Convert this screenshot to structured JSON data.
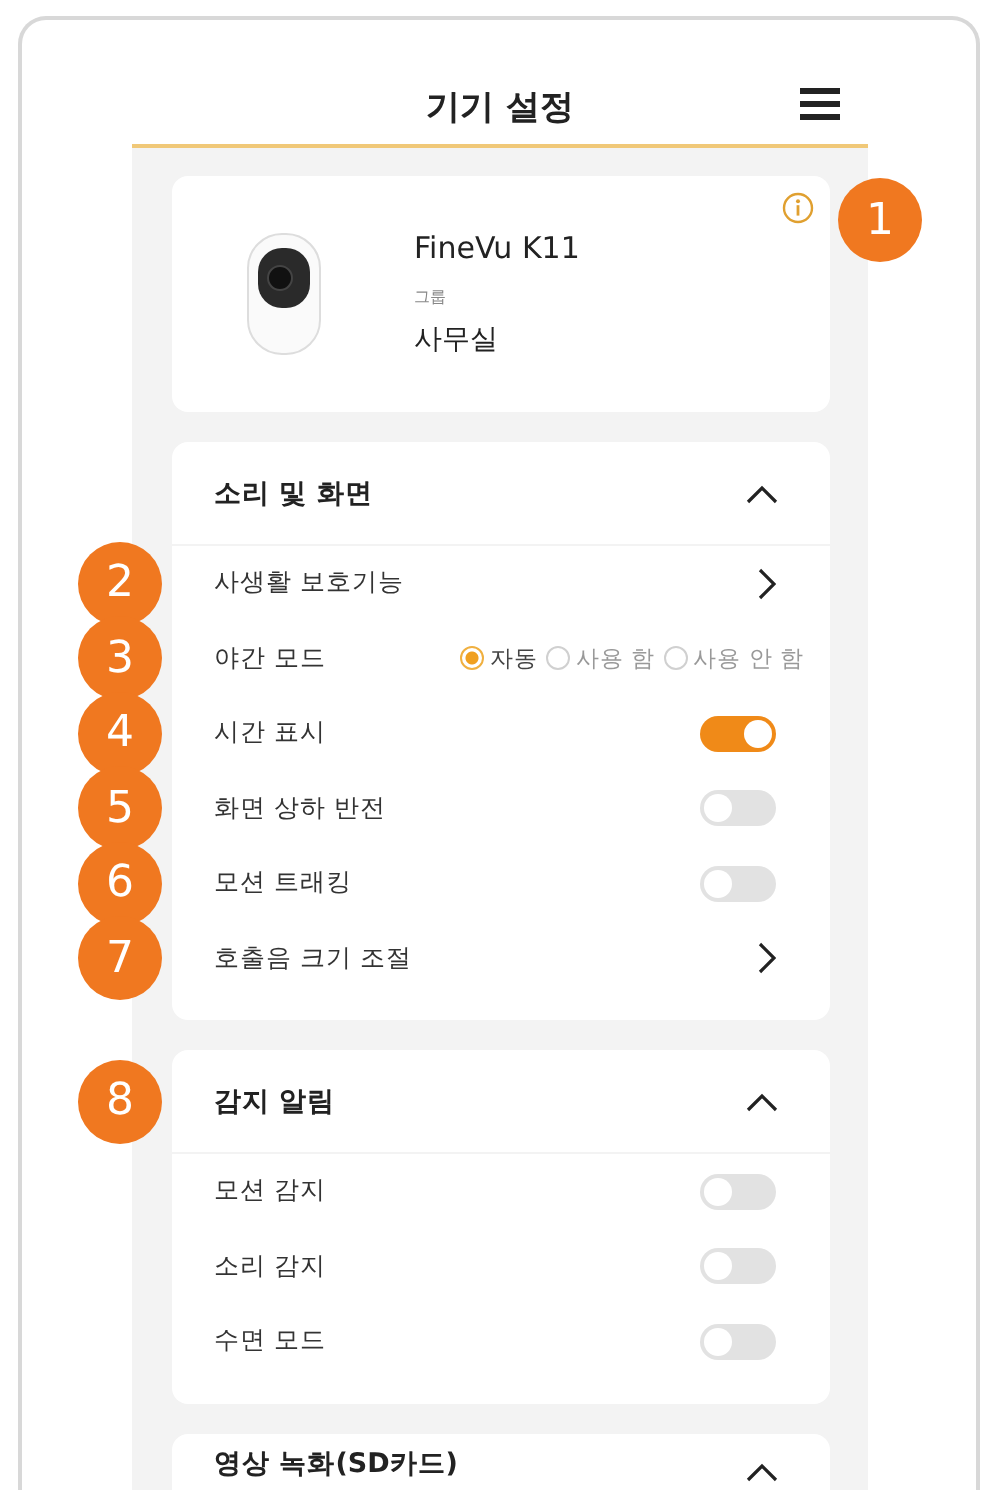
{
  "header": {
    "title": "기기 설정"
  },
  "device": {
    "name": "FineVu K11",
    "group_label": "그룹",
    "group": "사무실",
    "marker": "1"
  },
  "sections": [
    {
      "title": "소리 및 화면",
      "expanded": true,
      "rows": [
        {
          "kind": "link",
          "label": "사생활 보호기능",
          "marker": "2"
        },
        {
          "kind": "radio",
          "label": "야간 모드",
          "marker": "3",
          "options": [
            {
              "label": "자동",
              "selected": true
            },
            {
              "label": "사용 함",
              "selected": false
            },
            {
              "label": "사용 안 함",
              "selected": false
            }
          ]
        },
        {
          "kind": "toggle",
          "label": "시간 표시",
          "marker": "4",
          "on": true
        },
        {
          "kind": "toggle",
          "label": "화면 상하 반전",
          "marker": "5",
          "on": false
        },
        {
          "kind": "toggle",
          "label": "모션 트래킹",
          "marker": "6",
          "on": false
        },
        {
          "kind": "link",
          "label": "호출음 크기 조절",
          "marker": "7"
        }
      ]
    },
    {
      "title": "감지 알림",
      "expanded": true,
      "marker": "8",
      "rows": [
        {
          "kind": "toggle",
          "label": "모션 감지",
          "on": false
        },
        {
          "kind": "toggle",
          "label": "소리 감지",
          "on": false
        },
        {
          "kind": "toggle",
          "label": "수면 모드",
          "on": false
        }
      ]
    },
    {
      "title": "영상 녹화(SD카드)",
      "expanded": true
    }
  ]
}
